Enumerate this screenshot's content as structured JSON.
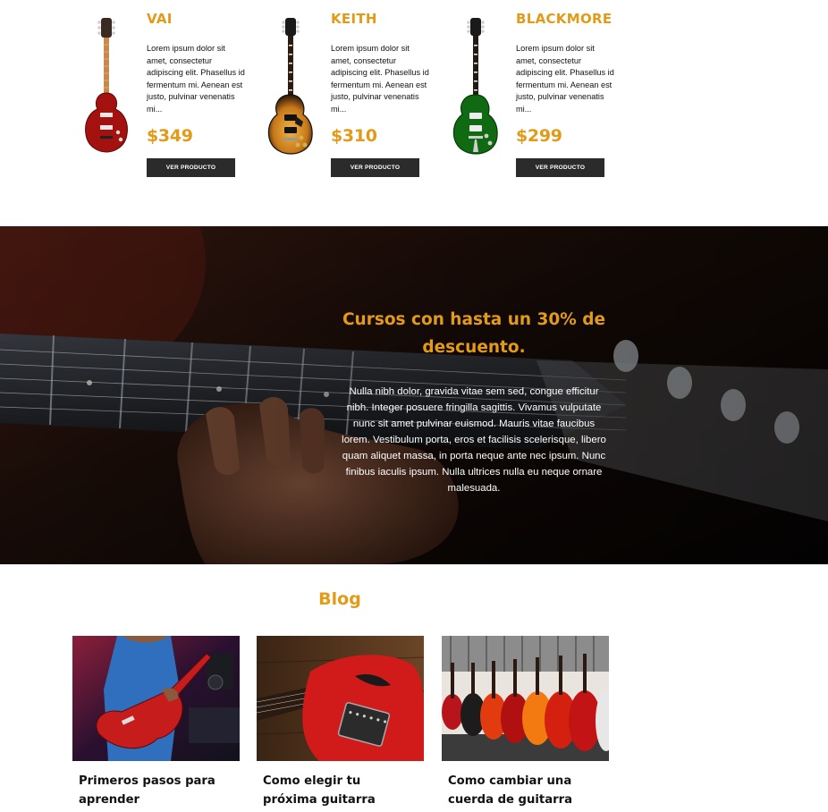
{
  "products": [
    {
      "name": "VAI",
      "description": "Lorem ipsum dolor sit amet, consectetur adipiscing elit. Phasellus id fermentum mi. Aenean est justo, pulvinar venenatis mi...",
      "price": "$349",
      "button_label": "VER PRODUCTO",
      "body_color": "#a3120e"
    },
    {
      "name": "KEITH",
      "description": "Lorem ipsum dolor sit amet, consectetur adipiscing elit. Phasellus id fermentum mi. Aenean est justo, pulvinar venenatis mi...",
      "price": "$310",
      "button_label": "VER PRODUCTO",
      "body_color": "#d88a1c"
    },
    {
      "name": "BLACKMORE",
      "description": "Lorem ipsum dolor sit amet, consectetur adipiscing elit. Phasellus id fermentum mi. Aenean est justo, pulvinar venenatis mi...",
      "price": "$299",
      "button_label": "VER PRODUCTO",
      "body_color": "#0f6a12"
    }
  ],
  "promo": {
    "title": "Cursos con hasta un 30% de descuento.",
    "text": "Nulla nibh dolor, gravida vitae sem sed, congue efficitur nibh. Integer posuere fringilla sagittis. Vivamus vulputate nunc sit amet pulvinar euismod. Mauris vitae faucibus lorem. Vestibulum porta, eros et facilisis scelerisque, libero quam aliquet massa, in porta neque ante nec ipsum. Nunc finibus iaculis ipsum. Nulla ultrices nulla eu neque ornare malesuada."
  },
  "blog": {
    "title": "Blog",
    "posts": [
      {
        "title": "Primeros pasos para aprender"
      },
      {
        "title": "Como elegir tu próxima guitarra"
      },
      {
        "title": "Como cambiar una cuerda de guitarra"
      }
    ]
  },
  "colors": {
    "accent": "#e39a17",
    "button_bg": "#2b2b2b"
  }
}
